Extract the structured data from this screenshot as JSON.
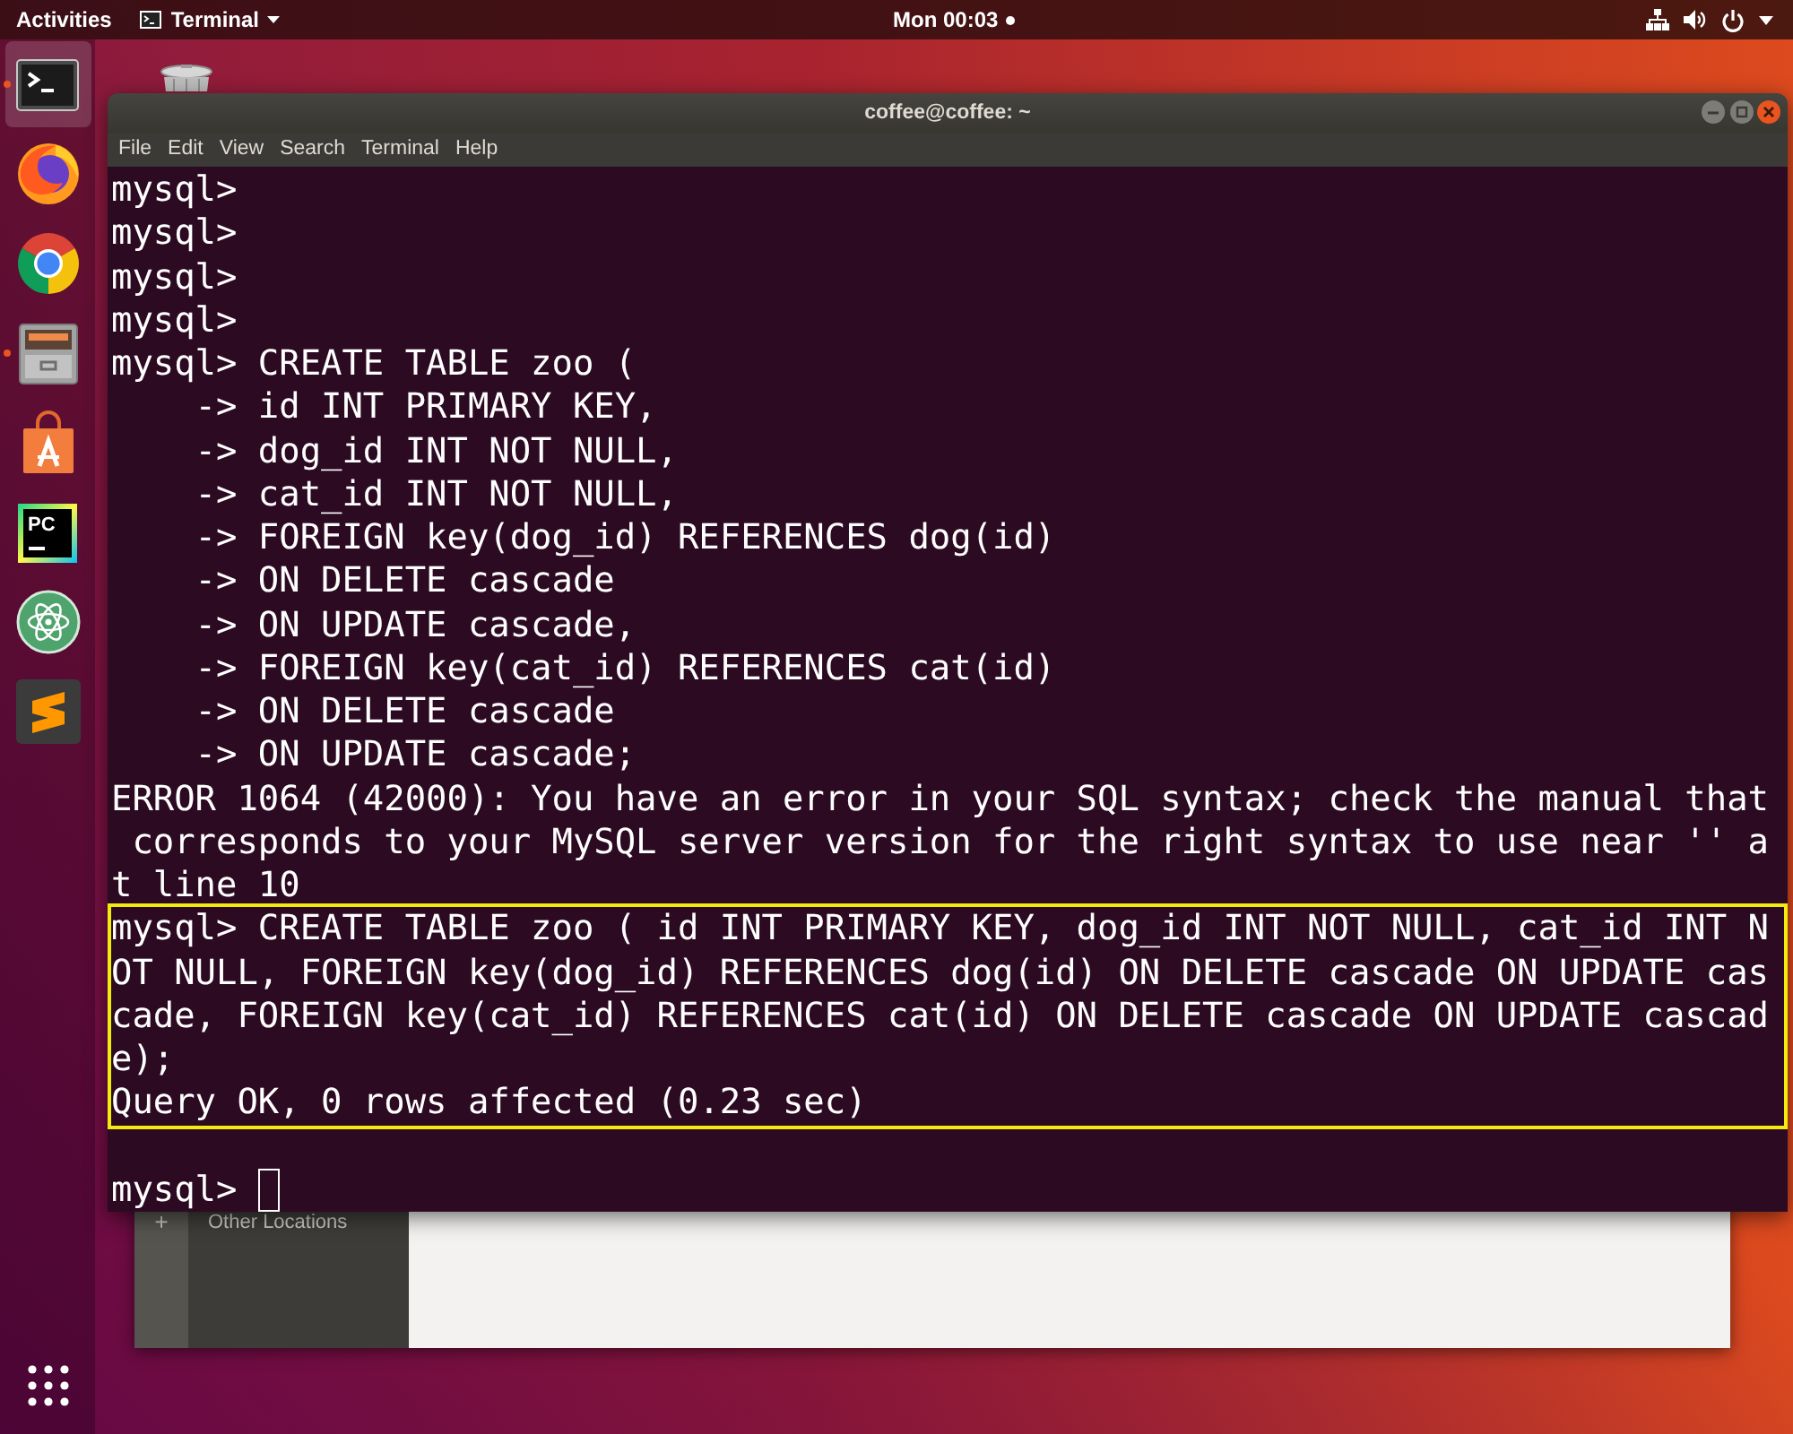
{
  "top_bar": {
    "activities": "Activities",
    "app_menu": "Terminal",
    "clock": "Mon 00:03"
  },
  "dock": {
    "items": [
      {
        "running": true,
        "selected": true
      },
      {
        "running": false,
        "selected": false
      },
      {
        "running": false,
        "selected": false
      },
      {
        "running": true,
        "selected": false
      },
      {
        "running": false,
        "selected": false
      },
      {
        "running": false,
        "selected": false,
        "logo_text": "PC"
      },
      {
        "running": false,
        "selected": false
      },
      {
        "running": false,
        "selected": false
      }
    ]
  },
  "file_manager": {
    "sidebar_items": [
      {
        "icon": "+",
        "label": "Other Locations"
      }
    ]
  },
  "terminal": {
    "title": "coffee@coffee: ~",
    "menu": [
      "File",
      "Edit",
      "View",
      "Search",
      "Terminal",
      "Help"
    ],
    "lines": [
      "mysql>",
      "mysql>",
      "mysql>",
      "mysql>",
      "mysql> CREATE TABLE zoo (",
      "    -> id INT PRIMARY KEY,",
      "    -> dog_id INT NOT NULL,",
      "    -> cat_id INT NOT NULL,",
      "    -> FOREIGN key(dog_id) REFERENCES dog(id)",
      "    -> ON DELETE cascade",
      "    -> ON UPDATE cascade,",
      "    -> FOREIGN key(cat_id) REFERENCES cat(id)",
      "    -> ON DELETE cascade",
      "    -> ON UPDATE cascade;",
      "ERROR 1064 (42000): You have an error in your SQL syntax; check the manual that",
      " corresponds to your MySQL server version for the right syntax to use near '' a",
      "t line 10"
    ],
    "highlighted_lines": [
      "mysql> CREATE TABLE zoo ( id INT PRIMARY KEY, dog_id INT NOT NULL, cat_id INT N",
      "OT NULL, FOREIGN key(dog_id) REFERENCES dog(id) ON DELETE cascade ON UPDATE cas",
      "cade, FOREIGN key(cat_id) REFERENCES cat(id) ON DELETE cascade ON UPDATE cascad",
      "e);",
      "Query OK, 0 rows affected (0.23 sec)"
    ],
    "prompt": "mysql>"
  }
}
